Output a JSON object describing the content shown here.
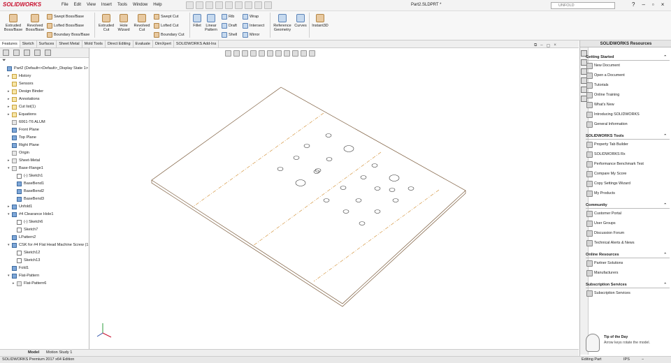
{
  "app": {
    "logo": "SOLIDWORKS",
    "doc_title": "Part2.SLDPRT *"
  },
  "menu": [
    "File",
    "Edit",
    "View",
    "Insert",
    "Tools",
    "Window",
    "Help"
  ],
  "search": {
    "value": "UNFOLD"
  },
  "ribbon": {
    "extruded_boss": "Extruded\nBoss/Base",
    "revolved_boss": "Revolved\nBoss/Base",
    "swept_boss": "Swept Boss/Base",
    "lofted_boss": "Lofted Boss/Base",
    "boundary_boss": "Boundary Boss/Base",
    "extruded_cut": "Extruded\nCut",
    "hole_wizard": "Hole\nWizard",
    "revolved_cut": "Revolved\nCut",
    "swept_cut": "Swept Cut",
    "lofted_cut": "Lofted Cut",
    "boundary_cut": "Boundary Cut",
    "fillet": "Fillet",
    "linear_pattern": "Linear\nPattern",
    "rib": "Rib",
    "draft": "Draft",
    "shell": "Shell",
    "wrap": "Wrap",
    "intersect": "Intersect",
    "mirror": "Mirror",
    "reference_geometry": "Reference\nGeometry",
    "curves": "Curves",
    "instant3d": "Instant3D"
  },
  "tabs": [
    "Features",
    "Sketch",
    "Surfaces",
    "Sheet Metal",
    "Mold Tools",
    "Direct Editing",
    "Evaluate",
    "DimXpert",
    "SOLIDWORKS Add-Ins"
  ],
  "tree": [
    {
      "label": "Part2  (Default<<Default>_Display State 1>",
      "indent": 0,
      "toggle": "",
      "icon": "p"
    },
    {
      "label": "History",
      "indent": 1,
      "toggle": "▸",
      "icon": "f"
    },
    {
      "label": "Sensors",
      "indent": 1,
      "toggle": "",
      "icon": "f"
    },
    {
      "label": "Design Binder",
      "indent": 1,
      "toggle": "▸",
      "icon": "f"
    },
    {
      "label": "Annotations",
      "indent": 1,
      "toggle": "▸",
      "icon": "f"
    },
    {
      "label": "Cut list(1)",
      "indent": 1,
      "toggle": "▸",
      "icon": "f"
    },
    {
      "label": "Equations",
      "indent": 1,
      "toggle": "▸",
      "icon": "f"
    },
    {
      "label": "6061-T6 ALUM",
      "indent": 1,
      "toggle": "",
      "icon": "b"
    },
    {
      "label": "Front Plane",
      "indent": 1,
      "toggle": "",
      "icon": "p"
    },
    {
      "label": "Top Plane",
      "indent": 1,
      "toggle": "",
      "icon": "p"
    },
    {
      "label": "Right Plane",
      "indent": 1,
      "toggle": "",
      "icon": "p"
    },
    {
      "label": "Origin",
      "indent": 1,
      "toggle": "",
      "icon": "b"
    },
    {
      "label": "Sheet-Metal",
      "indent": 1,
      "toggle": "▸",
      "icon": "b"
    },
    {
      "label": "Base-Flange1",
      "indent": 1,
      "toggle": "▾",
      "icon": "b"
    },
    {
      "label": "(-) Sketch1",
      "indent": 2,
      "toggle": "",
      "icon": "s"
    },
    {
      "label": "BaseBend1",
      "indent": 2,
      "toggle": "",
      "icon": "p"
    },
    {
      "label": "BaseBend2",
      "indent": 2,
      "toggle": "",
      "icon": "p"
    },
    {
      "label": "BaseBend3",
      "indent": 2,
      "toggle": "",
      "icon": "p"
    },
    {
      "label": "Unfold1",
      "indent": 1,
      "toggle": "▸",
      "icon": "p"
    },
    {
      "label": "#4 Clearance Hole1",
      "indent": 1,
      "toggle": "▾",
      "icon": "p"
    },
    {
      "label": "(-) Sketch6",
      "indent": 2,
      "toggle": "",
      "icon": "s"
    },
    {
      "label": "Sketch7",
      "indent": 2,
      "toggle": "",
      "icon": "s"
    },
    {
      "label": "LPattern2",
      "indent": 1,
      "toggle": "",
      "icon": "p"
    },
    {
      "label": "CSK for #4 Flat Head Machine Screw (1",
      "indent": 1,
      "toggle": "▾",
      "icon": "p"
    },
    {
      "label": "Sketch12",
      "indent": 2,
      "toggle": "",
      "icon": "s"
    },
    {
      "label": "Sketch13",
      "indent": 2,
      "toggle": "",
      "icon": "s"
    },
    {
      "label": "Fold1",
      "indent": 1,
      "toggle": "",
      "icon": "p"
    },
    {
      "label": "Flat-Pattern",
      "indent": 1,
      "toggle": "▾",
      "icon": "p"
    },
    {
      "label": "Flat-Pattern6",
      "indent": 2,
      "toggle": "▸",
      "icon": "b"
    }
  ],
  "resources": {
    "title": "SOLIDWORKS Resources",
    "sections": [
      {
        "title": "Getting Started",
        "items": [
          "New Document",
          "Open a Document",
          "Tutorials",
          "Online Training",
          "What's New",
          "Introducing SOLIDWORKS",
          "General Information"
        ]
      },
      {
        "title": "SOLIDWORKS Tools",
        "items": [
          "Property Tab Builder",
          "SOLIDWORKS Rx",
          "Performance Benchmark Test",
          "Compare My Score",
          "Copy Settings Wizard",
          "My Products"
        ]
      },
      {
        "title": "Community",
        "items": [
          "Customer Portal",
          "User Groups",
          "Discussion Forum",
          "Technical Alerts & News"
        ]
      },
      {
        "title": "Online Resources",
        "items": [
          "Partner Solutions",
          "Manufacturers"
        ]
      },
      {
        "title": "Subscription Services",
        "items": [
          "Subscription Services"
        ]
      }
    ],
    "tip_title": "Tip of the Day",
    "tip_text": "Arrow keys rotate the model."
  },
  "bottom_tabs": [
    "Model",
    "Motion Study 1"
  ],
  "status": {
    "left": "SOLIDWORKS Premium 2017 x64 Edition",
    "editing": "Editing Part",
    "units": "IPS",
    "arrow": "−"
  },
  "colors": {
    "accent": "#c8102e",
    "edge": "#7a5a3a",
    "bend_line": "#d08a2a"
  }
}
